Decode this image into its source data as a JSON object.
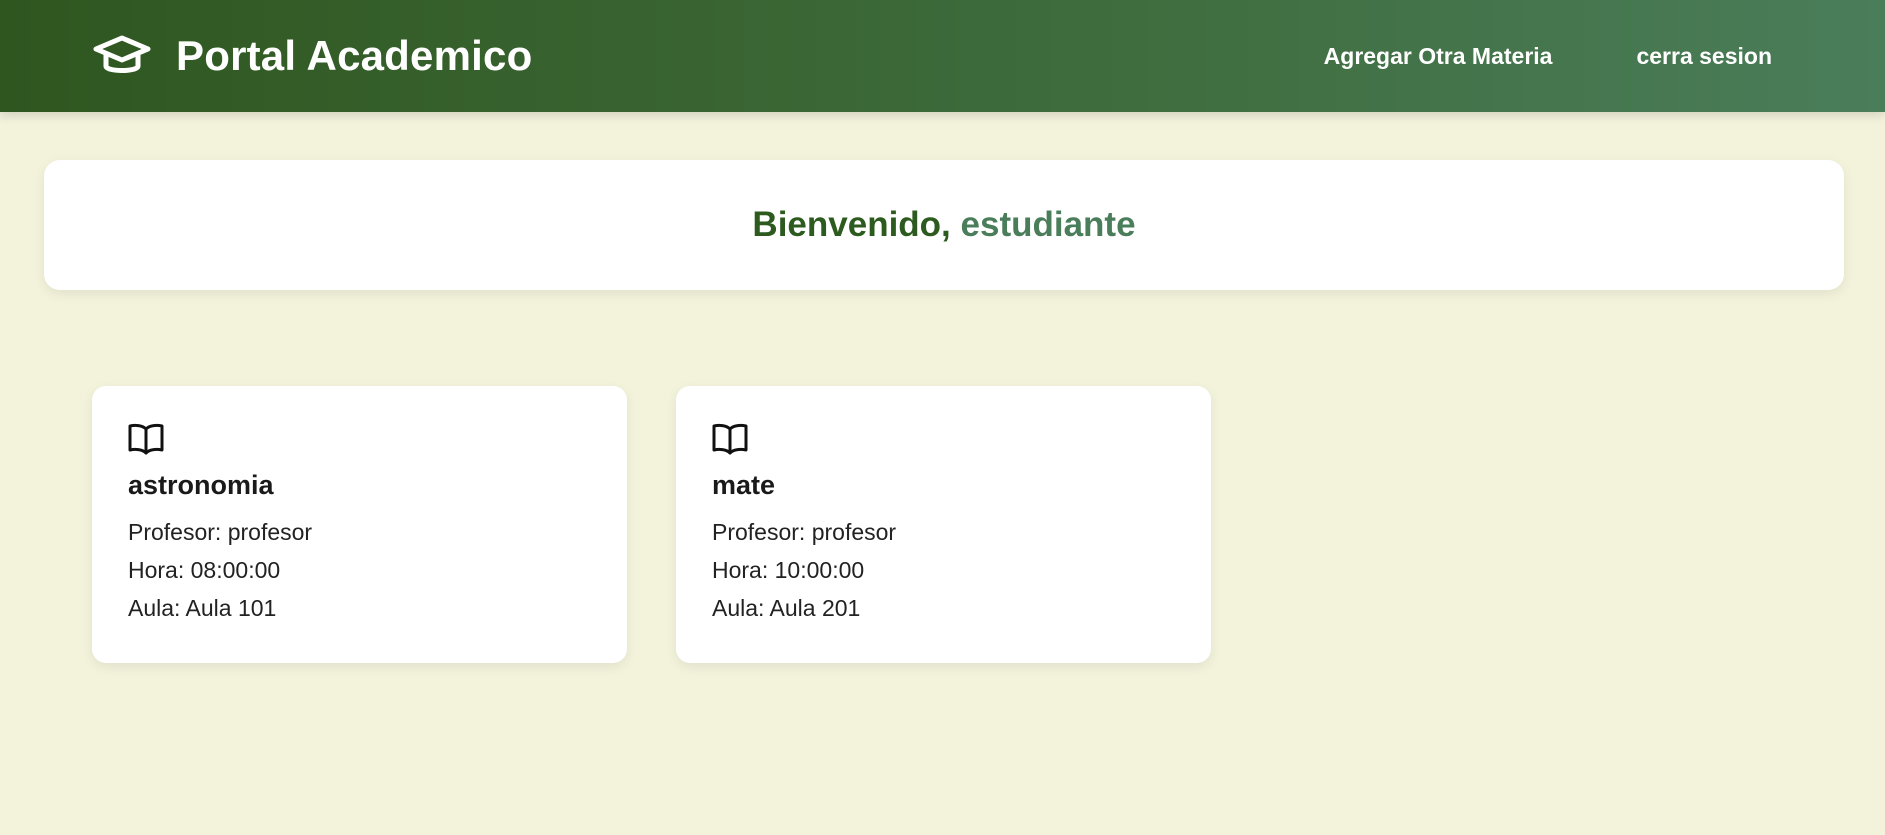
{
  "header": {
    "logo_icon": "graduation-cap-icon",
    "title": "Portal Academico",
    "nav": {
      "add_subject": "Agregar Otra Materia",
      "logout": "cerra sesion"
    }
  },
  "welcome": {
    "greeting": "Bienvenido, ",
    "name": "estudiante"
  },
  "courses": [
    {
      "icon": "book-open-icon",
      "name": "astronomia",
      "teacher": "Profesor: profesor",
      "time": "Hora: 08:00:00",
      "room": "Aula: Aula 101"
    },
    {
      "icon": "book-open-icon",
      "name": "mate",
      "teacher": "Profesor: profesor",
      "time": "Hora: 10:00:00",
      "room": "Aula: Aula 201"
    }
  ],
  "colors": {
    "header_start": "#2f561f",
    "header_end": "#4a7d5a",
    "page_bg": "#f3f3dc",
    "welcome_text": "#2d5a1f",
    "welcome_name": "#4a7d5a"
  }
}
